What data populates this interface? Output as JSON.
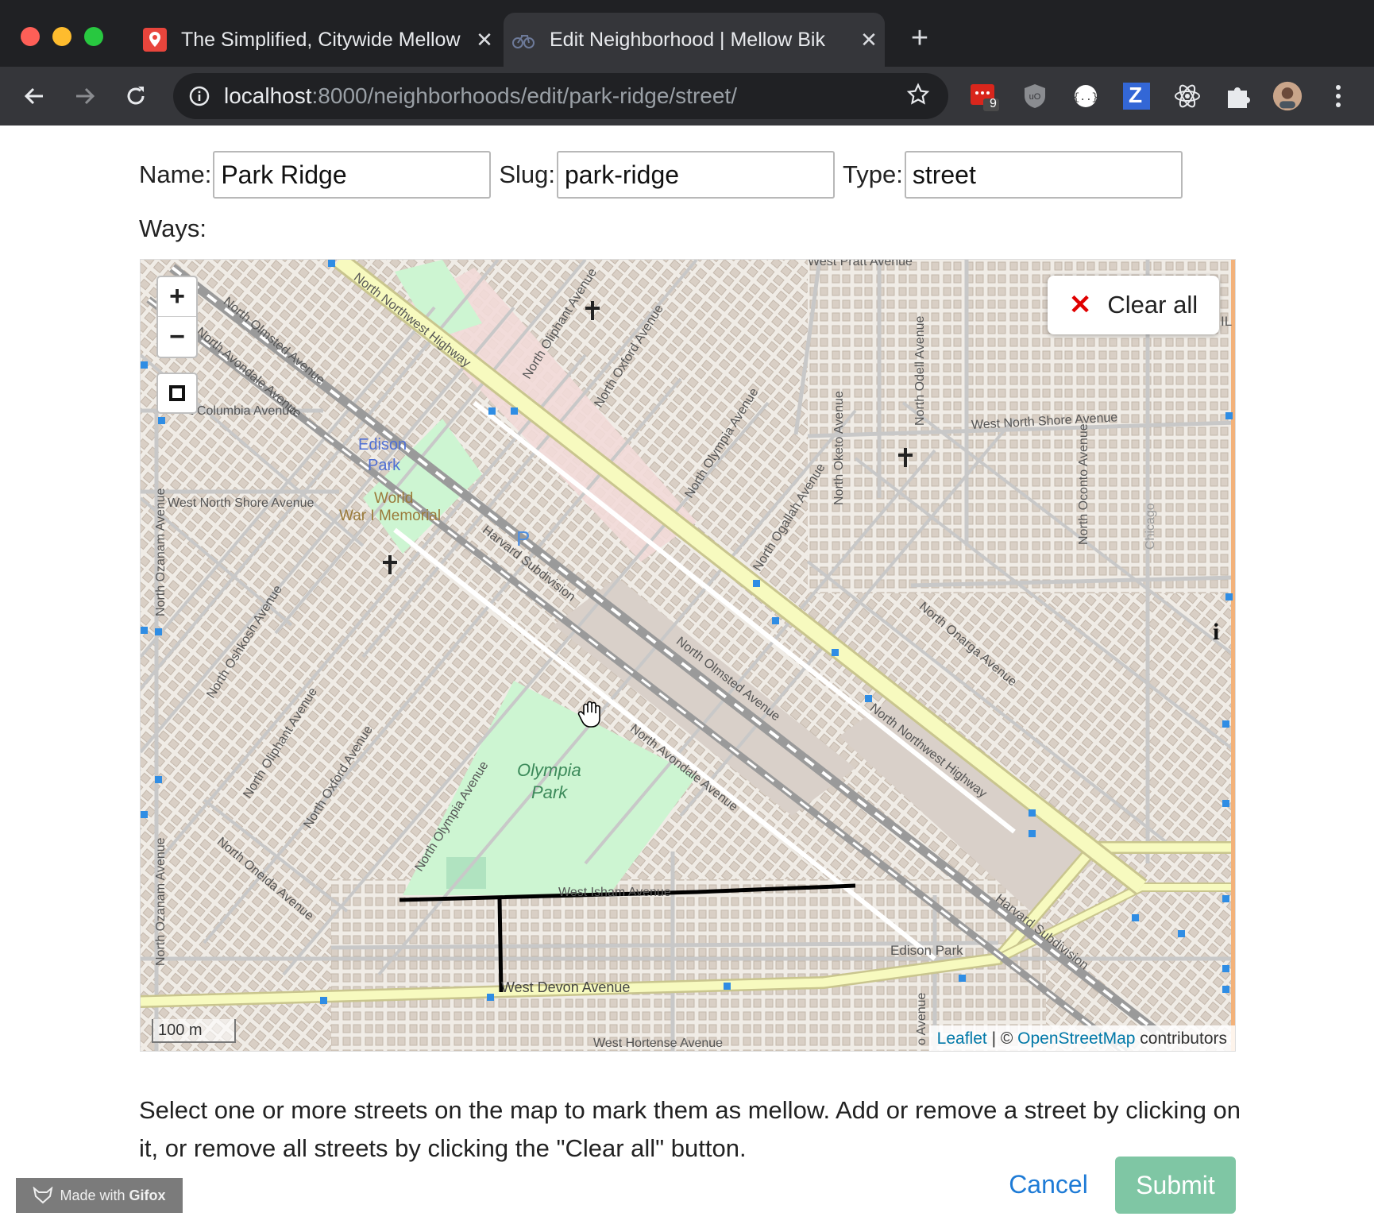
{
  "browser": {
    "tabs": [
      {
        "title": "The Simplified, Citywide Mellow",
        "active": false
      },
      {
        "title": "Edit Neighborhood | Mellow Bik",
        "active": true
      }
    ],
    "url_host": "localhost",
    "url_path": ":8000/neighborhoods/edit/park-ridge/street/",
    "extension_badge": "9",
    "extension_z": "Z"
  },
  "form": {
    "name_label": "Name:",
    "name_value": "Park Ridge",
    "slug_label": "Slug:",
    "slug_value": "park-ridge",
    "type_label": "Type:",
    "type_value": "street",
    "ways_label": "Ways:"
  },
  "map": {
    "zoom_in": "+",
    "zoom_out": "−",
    "clear_all_label": "Clear all",
    "scale_label": "100 m",
    "attribution_leaflet": "Leaflet",
    "attribution_sep": " | © ",
    "attribution_osm": "OpenStreetMap",
    "attribution_suffix": " contributors",
    "places": {
      "edison_park_1": "Edison",
      "edison_park_2": "Park",
      "memorial_1": "World",
      "memorial_2": "War I Memorial",
      "olympia_1": "Olympia",
      "olympia_2": "Park",
      "parking": "P"
    },
    "streets": {
      "pratt": "West Pratt Avenue",
      "nw_hwy_top": "North Northwest Highway",
      "nw_hwy_bottom": "North Northwest Highway",
      "olmsted_top": "North Olmsted Avenue",
      "olmsted_mid": "North Olmsted Avenue",
      "avondale_top": "North Avondale Avenue",
      "avondale_mid": "North Avondale Avenue",
      "columbia": "t Columbia Avenue",
      "north_shore_west": "West North Shore Avenue",
      "north_shore_east": "West North Shore Avenue",
      "oliphant_top": "North Oliphant Avenue",
      "oxford_top": "North Oxford Avenue",
      "olympia_top": "North Olympia Avenue",
      "ogallah": "North Ogallah Avenue",
      "oketo": "North Oketo Avenue",
      "odell": "North Odell Avenue",
      "oconto": "North Oconto Avenue",
      "chicago": "Chicago",
      "ozanam_top": "North Ozanam Avenue",
      "ozanam_bottom": "North Ozanam Avenue",
      "oshkosh": "North Oshkosh Avenue",
      "oliphant_bottom": "North Oliphant Avenue",
      "oxford_bottom": "North Oxford Avenue",
      "olympia_bottom": "North Olympia Avenue",
      "oneida": "North Oneida Avenue",
      "onarga": "North Onarga Avenue",
      "harvard_top": "Harvard Subdivision",
      "harvard_bottom": "Harvard Subdivision",
      "isham": "West Isham Avenue",
      "devon": "West Devon Avenue",
      "hortense": "West Hortense Avenue",
      "edison_park_street": "Edison Park",
      "avenue_bottom": "o Avenue",
      "il": "IL"
    }
  },
  "instructions": "Select one or more streets on the map to mark them as mellow. Add or remove a street by clicking on it, or remove all streets by clicking the \"Clear all\" button.",
  "actions": {
    "cancel_label": "Cancel",
    "submit_label": "Submit"
  },
  "watermark": {
    "prefix": "Made with",
    "brand": "Gifox"
  },
  "colors": {
    "highway_fill": "#f7fabf",
    "park_green": "#cdf5d2",
    "selected_way": "#000000",
    "submit": "#7fc6a4",
    "clear_x": "#e00000"
  }
}
